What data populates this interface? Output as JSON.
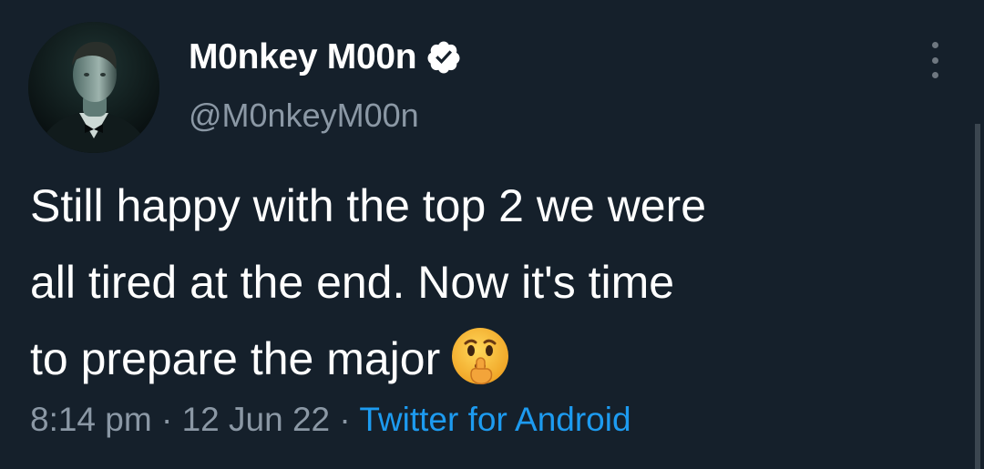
{
  "tweet": {
    "author": {
      "display_name": "M0nkey M00n",
      "handle": "@M0nkeyM00n",
      "verified": true
    },
    "text_lines": [
      "Still happy with the top 2 we were",
      "all tired at the end. Now it's time",
      "to prepare the major"
    ],
    "emoji": "shushing-face",
    "meta": {
      "time": "8:14 pm",
      "separator": "·",
      "date": "12 Jun 22",
      "source": "Twitter for Android"
    }
  },
  "icons": {
    "verified": "verified-badge-icon",
    "more": "more-vertical-icon"
  },
  "colors": {
    "background": "#15202b",
    "text": "#ffffff",
    "secondary_text": "#8b98a5",
    "link": "#1d9bf0"
  }
}
